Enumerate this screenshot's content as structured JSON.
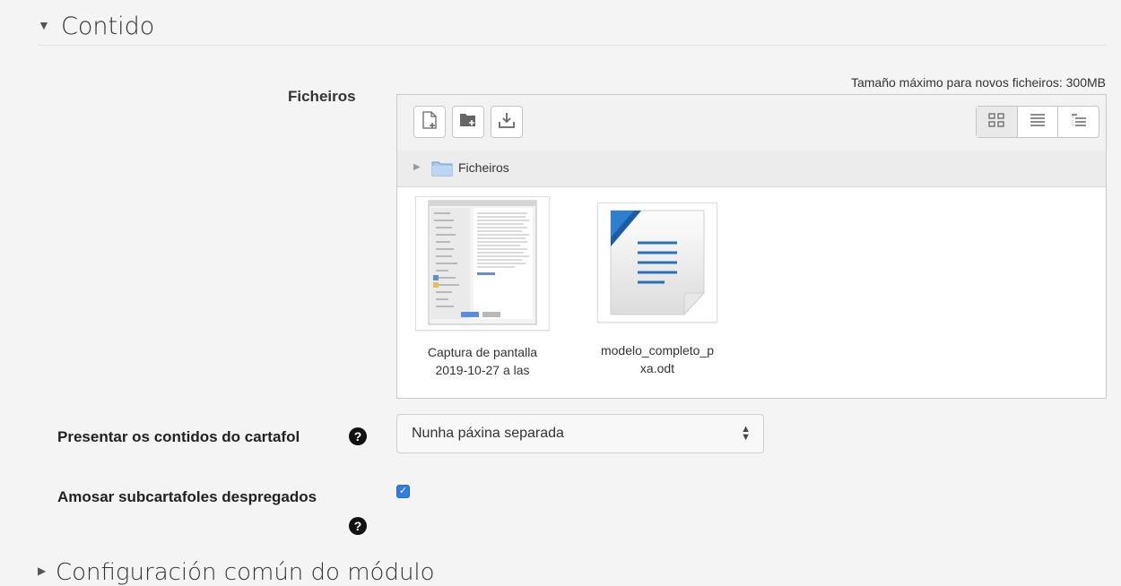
{
  "section": {
    "title": "Contido",
    "expanded": true
  },
  "files_field": {
    "label": "Ficheiros",
    "max_size_text": "Tamaño máximo para novos ficheiros: 300MB",
    "toolbar": {
      "add_file_icon": "file-plus-icon",
      "new_folder_icon": "folder-plus-icon",
      "download_icon": "download-icon"
    },
    "views": [
      "grid-view-icon",
      "list-view-icon",
      "tree-view-icon"
    ],
    "path": {
      "folder_name": "Ficheiros"
    },
    "files": [
      {
        "name_line1": "Captura de pantalla",
        "name_line2": "2019-10-27 a las",
        "icon": "screenshot-thumbnail"
      },
      {
        "name_line1": "modelo_completo_p",
        "name_line2": "xa.odt",
        "icon": "odt-document-icon"
      }
    ]
  },
  "display_option": {
    "label": "Presentar os contidos do cartafol",
    "selected": "Nunha páxina separada"
  },
  "subfolders_option": {
    "label": "Amosar subcartafoles despregados",
    "checked": true
  },
  "next_section": {
    "title": "Configuración común do módulo"
  },
  "colors": {
    "accent": "#2f7de1",
    "background": "#f4f4f4"
  }
}
